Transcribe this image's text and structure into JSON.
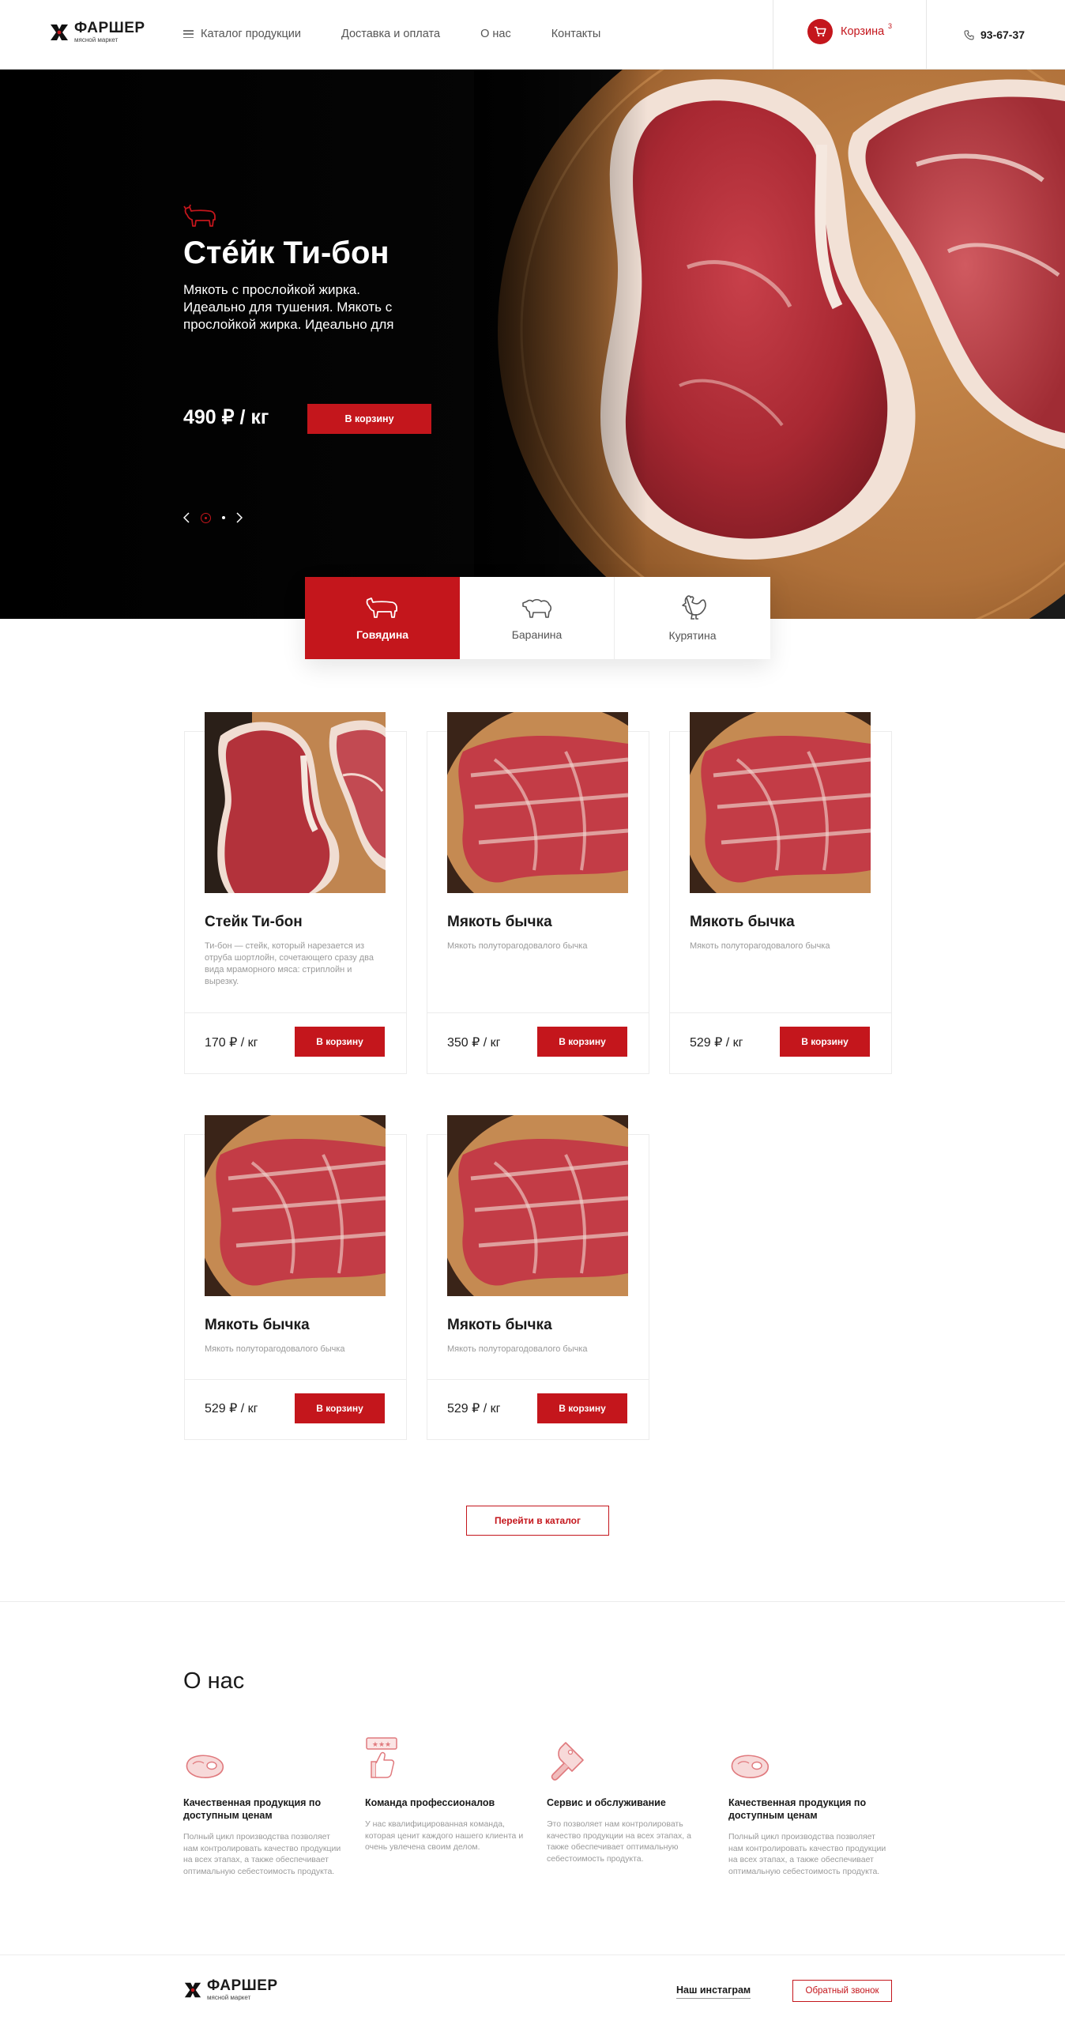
{
  "header": {
    "logo_name": "ФАРШЕР",
    "logo_sub": "мясной маркет",
    "nav": [
      {
        "label": "Каталог продукции",
        "icon": "menu-icon"
      },
      {
        "label": "Доставка и оплата"
      },
      {
        "label": "О нас"
      },
      {
        "label": "Контакты"
      }
    ],
    "cart_label": "Корзина",
    "cart_count": "3",
    "phone": "93-67-37"
  },
  "hero": {
    "icon": "cow-icon",
    "title": "Стéйк Ти-бон",
    "description": "Мякоть с прослойкой жирка. Идеально для тушения. Мякоть с прослойкой жирка. Идеально для",
    "price": "490 ₽ / кг",
    "button_label": "В корзину"
  },
  "categories": [
    {
      "label": "Говядина",
      "icon": "cow-icon",
      "active": true
    },
    {
      "label": "Баранина",
      "icon": "sheep-icon",
      "active": false
    },
    {
      "label": "Курятина",
      "icon": "rooster-icon",
      "active": false
    }
  ],
  "products": [
    {
      "title": "Стейк Ти-бон",
      "description": "Ти-бон — стейк, который нарезается из отруба шортлойн, сочетающего сразу два вида мраморного мяса: стриплойн и вырезку.",
      "price": "170 ₽ / кг",
      "button_label": "В корзину"
    },
    {
      "title": "Мякоть бычка",
      "description": "Мякоть полуторагодовалого бычка",
      "price": "350 ₽ / кг",
      "button_label": "В корзину"
    },
    {
      "title": "Мякоть бычка",
      "description": "Мякоть полуторагодовалого бычка",
      "price": "529 ₽ / кг",
      "button_label": "В корзину"
    },
    {
      "title": "Мякоть бычка",
      "description": "Мякоть полуторагодовалого бычка",
      "price": "529 ₽ / кг",
      "button_label": "В корзину"
    },
    {
      "title": "Мякоть бычка",
      "description": "Мякоть полуторагодовалого бычка",
      "price": "529 ₽ / кг",
      "button_label": "В корзину"
    }
  ],
  "catalog_button": "Перейти в каталог",
  "about": {
    "title": "О нас",
    "features": [
      {
        "icon": "meat-icon",
        "title": "Качественная продукция по доступным ценам",
        "text": "Полный цикл производства позволяет нам контролировать качество продукции на всех этапах, а также обеспечивает оптимальную себестоимость продукта."
      },
      {
        "icon": "thumbs-up-rating-icon",
        "title": "Команда профессионалов",
        "text": "У нас квалифицированная команда, которая ценит каждого нашего клиента и очень увлечена своим делом."
      },
      {
        "icon": "cleaver-icon",
        "title": "Сервис и обслуживание",
        "text": "Это позволяет нам контролировать качество продукции на всех этапах, а также обеспечивает оптимальную себестоимость продукта."
      },
      {
        "icon": "meat-icon",
        "title": "Качественная продукция по доступным ценам",
        "text": "Полный цикл производства позволяет нам контролировать качество продукции на всех этапах, а также обеспечивает оптимальную себестоимость продукта."
      }
    ]
  },
  "footer": {
    "logo_name": "ФАРШЕР",
    "logo_sub": "мясной маркет",
    "instagram": "Наш инстаграм",
    "callback": "Обратный звонок"
  },
  "colors": {
    "accent": "#c4161c",
    "dark": "#000000",
    "text": "#1a1a1a",
    "muted": "#9a9a9a"
  }
}
